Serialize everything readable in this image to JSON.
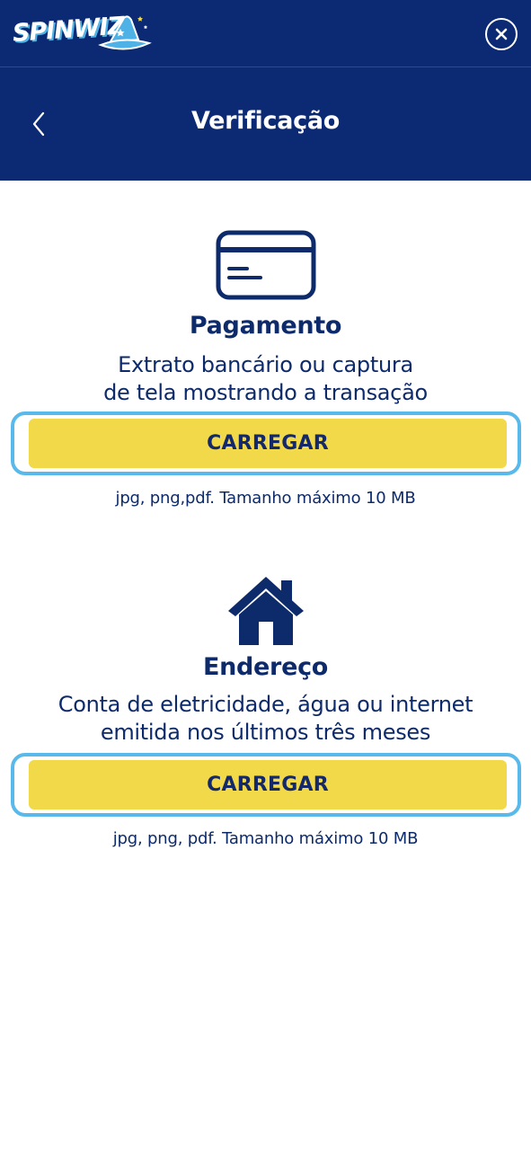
{
  "header": {
    "logo_text": "SPINWIZ",
    "close_icon": "close-icon"
  },
  "titlebar": {
    "back_icon": "chevron-left-icon",
    "title": "Verificação"
  },
  "sections": [
    {
      "icon": "credit-card-icon",
      "heading": "Pagamento",
      "description_line1": "Extrato bancário ou captura",
      "description_line2": "de tela mostrando a transação",
      "button_label": "CARREGAR",
      "hint": "jpg, png,pdf. Tamanho máximo 10 MB"
    },
    {
      "icon": "house-icon",
      "heading": "Endereço",
      "description_line1": "Conta de eletricidade, água ou internet",
      "description_line2": "emitida nos últimos três meses",
      "button_label": "CARREGAR",
      "hint": "jpg, png, pdf. Tamanho máximo 10 MB"
    }
  ],
  "colors": {
    "header_bg": "#0b2a73",
    "text_primary": "#0d2a6b",
    "button_yellow": "#f2d94a",
    "highlight_blue": "#58b9ea"
  }
}
